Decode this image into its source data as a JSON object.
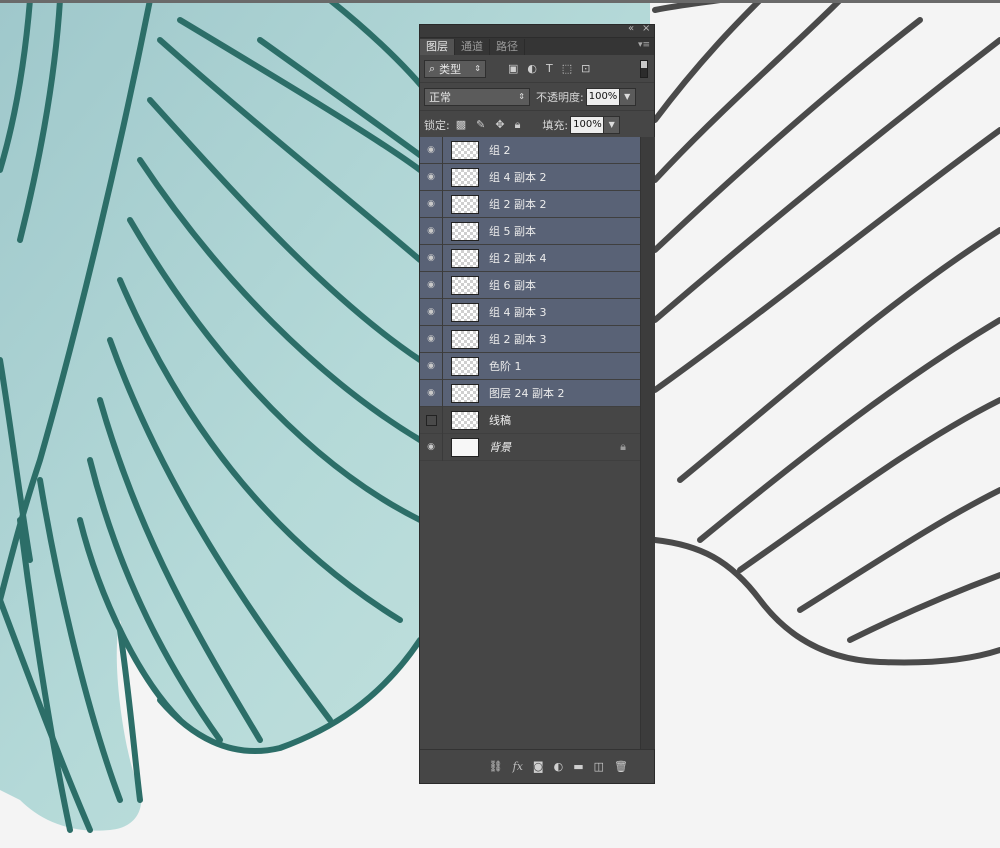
{
  "panel": {
    "tabs": [
      {
        "label": "图层",
        "active": true
      },
      {
        "label": "通道",
        "active": false
      },
      {
        "label": "路径",
        "active": false
      }
    ],
    "filter": {
      "selected": "类型"
    },
    "blend_mode": "正常",
    "opacity_label": "不透明度:",
    "opacity_value": "100%",
    "lock_label": "锁定:",
    "fill_label": "填充:",
    "fill_value": "100%",
    "layers": [
      {
        "name": "组 2",
        "visible": true,
        "selected": true
      },
      {
        "name": "组 4 副本 2",
        "visible": true,
        "selected": true
      },
      {
        "name": "组 2 副本 2",
        "visible": true,
        "selected": true
      },
      {
        "name": "组 5 副本",
        "visible": true,
        "selected": true
      },
      {
        "name": "组 2 副本 4",
        "visible": true,
        "selected": true
      },
      {
        "name": "组 6 副本",
        "visible": true,
        "selected": true
      },
      {
        "name": "组 4 副本 3",
        "visible": true,
        "selected": true
      },
      {
        "name": "组 2 副本 3",
        "visible": true,
        "selected": true
      },
      {
        "name": "色阶 1",
        "visible": true,
        "selected": true
      },
      {
        "name": "图层 24 副本 2",
        "visible": true,
        "selected": true
      },
      {
        "name": "线稿",
        "visible": false,
        "selected": false
      },
      {
        "name": "背景",
        "visible": true,
        "selected": false,
        "locked": true
      }
    ]
  },
  "colors": {
    "leaf_fill": "#a6cfcf",
    "leaf_line": "#2c6e68",
    "ink_line": "#4a4a4a",
    "panel_bg": "#464646",
    "selected_row": "#596276"
  }
}
